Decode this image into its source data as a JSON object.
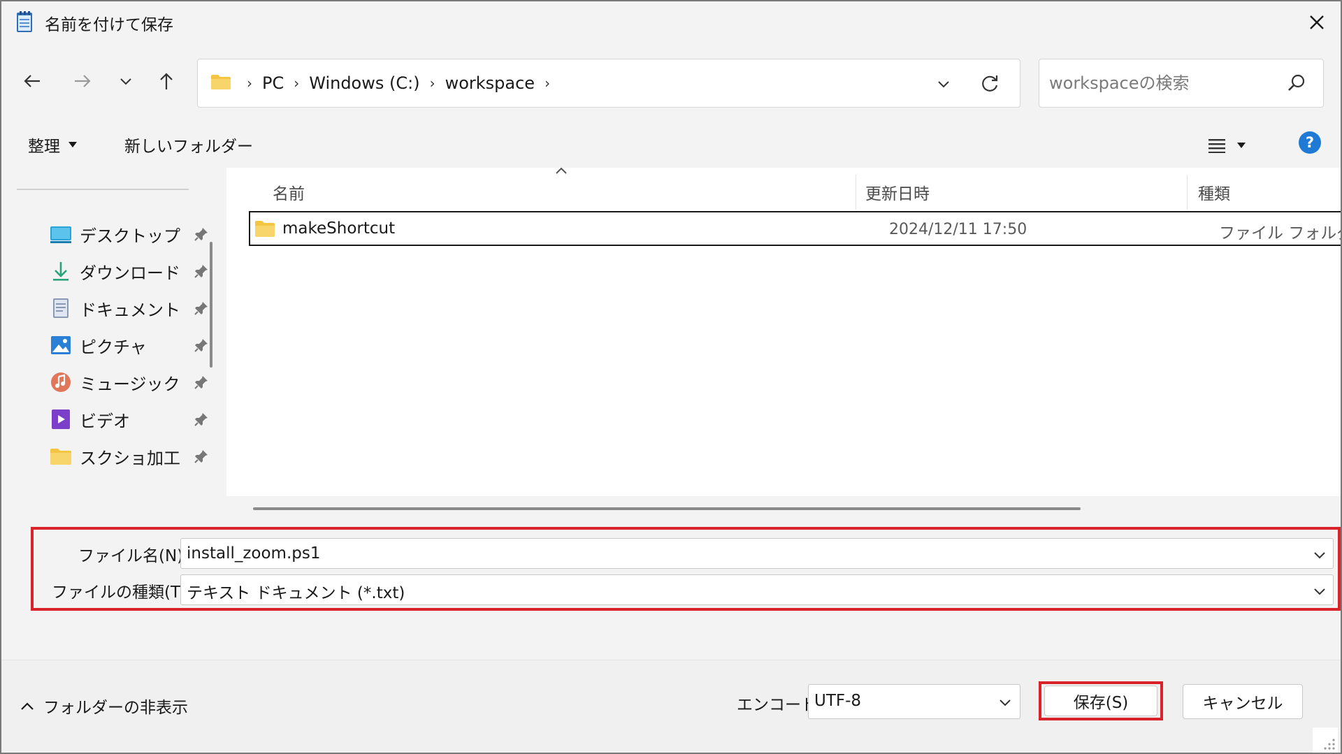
{
  "window": {
    "title": "名前を付けて保存",
    "icon": "notepad-icon"
  },
  "nav": {
    "back_icon": "arrow-left-icon",
    "forward_icon": "arrow-right-icon",
    "recent_icon": "chevron-down-icon",
    "up_icon": "arrow-up-icon",
    "breadcrumbs": [
      "PC",
      "Windows (C:)",
      "workspace"
    ],
    "search_placeholder": "workspaceの検索"
  },
  "toolbar": {
    "organize_label": "整理",
    "new_folder_label": "新しいフォルダー"
  },
  "sidebar": {
    "items": [
      {
        "label": "デスクトップ",
        "icon": "desktop-icon"
      },
      {
        "label": "ダウンロード",
        "icon": "download-icon"
      },
      {
        "label": "ドキュメント",
        "icon": "document-icon"
      },
      {
        "label": "ピクチャ",
        "icon": "picture-icon"
      },
      {
        "label": "ミュージック",
        "icon": "music-icon"
      },
      {
        "label": "ビデオ",
        "icon": "video-icon"
      },
      {
        "label": "スクショ加工",
        "icon": "folder-icon"
      }
    ]
  },
  "filelist": {
    "columns": {
      "name": "名前",
      "modified": "更新日時",
      "type": "種類"
    },
    "rows": [
      {
        "name": "makeShortcut",
        "modified": "2024/12/11 17:50",
        "type": "ファイル フォルダー"
      }
    ]
  },
  "form": {
    "filename_label": "ファイル名(N):",
    "filename_value": "install_zoom.ps1",
    "filetype_label": "ファイルの種類(T):",
    "filetype_value": "テキスト ドキュメント (*.txt)"
  },
  "footer": {
    "hide_folders_label": "フォルダーの非表示",
    "encoding_label": "エンコード:",
    "encoding_value": "UTF-8",
    "save_label": "保存(S)",
    "cancel_label": "キャンセル"
  },
  "colors": {
    "highlight": "#d8232a",
    "help": "#1f7ad6",
    "folder": "#f4c542"
  }
}
